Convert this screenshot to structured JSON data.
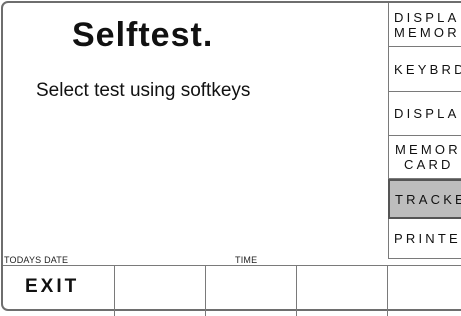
{
  "screen": {
    "title": "Selftest.",
    "instruction": "Select test using softkeys"
  },
  "softkeys": [
    {
      "lines": [
        "DISPLA",
        "MEMOR"
      ],
      "selected": false
    },
    {
      "lines": [
        "KEYBRD"
      ],
      "selected": false
    },
    {
      "lines": [
        "DISPLA"
      ],
      "selected": false
    },
    {
      "lines": [
        "MEMOR",
        "CARD"
      ],
      "selected": false
    },
    {
      "lines": [
        "TRACKE"
      ],
      "selected": true
    },
    {
      "lines": [
        "PRINTE"
      ],
      "selected": false
    }
  ],
  "status": {
    "date_label": "TODAYS DATE",
    "time_label": "TIME"
  },
  "bottom_keys": {
    "exit_label": "EXIT"
  }
}
